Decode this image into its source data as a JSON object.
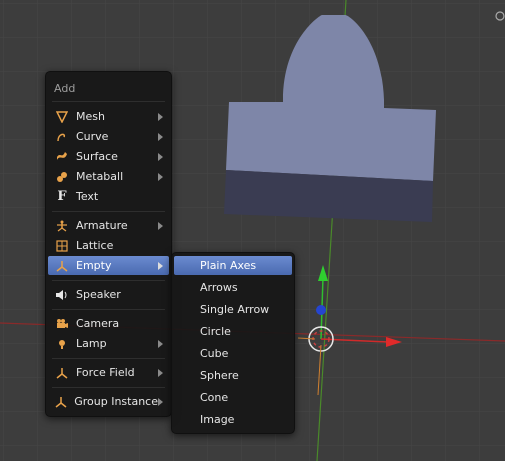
{
  "menu": {
    "title": "Add",
    "items": [
      {
        "label": "Mesh",
        "icon": "mesh-icon"
      },
      {
        "label": "Curve",
        "icon": "curve-icon"
      },
      {
        "label": "Surface",
        "icon": "surface-icon"
      },
      {
        "label": "Metaball",
        "icon": "metaball-icon"
      },
      {
        "label": "Text",
        "icon": "text-icon"
      },
      {
        "label": "Armature",
        "icon": "armature-icon"
      },
      {
        "label": "Lattice",
        "icon": "lattice-icon"
      },
      {
        "label": "Empty",
        "icon": "empty-icon"
      },
      {
        "label": "Speaker",
        "icon": "speaker-icon"
      },
      {
        "label": "Camera",
        "icon": "camera-icon"
      },
      {
        "label": "Lamp",
        "icon": "lamp-icon"
      },
      {
        "label": "Force Field",
        "icon": "force-field-icon"
      },
      {
        "label": "Group Instance",
        "icon": "group-instance-icon"
      }
    ]
  },
  "submenu": {
    "items": [
      "Plain Axes",
      "Arrows",
      "Single Arrow",
      "Circle",
      "Cube",
      "Sphere",
      "Cone",
      "Image"
    ]
  },
  "colors": {
    "accent": "#5b7cc4",
    "icon": "#e8a24a",
    "background": "#3d3d3d",
    "object": "#7e86a8"
  }
}
